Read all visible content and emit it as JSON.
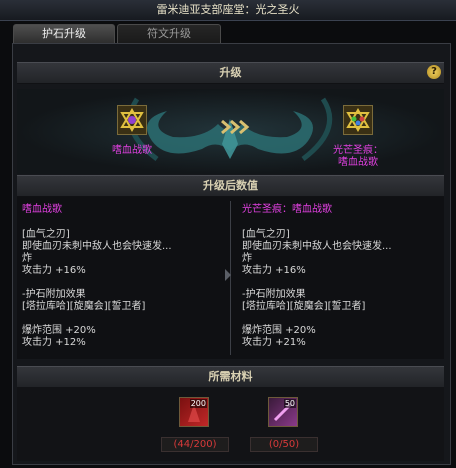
{
  "window": {
    "title": "雷米迪亚支部座堂：光之圣火"
  },
  "tabs": [
    {
      "label": "护石升级",
      "active": true
    },
    {
      "label": "符文升级",
      "active": false
    }
  ],
  "upgrade": {
    "header": "升级",
    "help": "?",
    "source_name": "嗜血战歌",
    "target_name_line1": "光芒圣痕：",
    "target_name_line2": "嗜血战歌"
  },
  "after": {
    "header": "升级后数值",
    "left": {
      "name": "嗜血战歌",
      "lines": [
        "[血气之刃]",
        "即使血刃未刺中敌人也会快速发...",
        "炸",
        "攻击力 +16%",
        "",
        "-护石附加效果",
        "[塔拉库哈][旋魔会][誓卫者]",
        "",
        "爆炸范围 +20%",
        "攻击力 +12%"
      ]
    },
    "right": {
      "name": "光芒圣痕：嗜血战歌",
      "lines": [
        "[血气之刃]",
        "即使血刃未刺中敌人也会快速发...",
        "炸",
        "攻击力 +16%",
        "",
        "-护石附加效果",
        "[塔拉库哈][旋魔会][誓卫者]",
        "",
        "爆炸范围 +20%",
        "攻击力 +21%"
      ]
    }
  },
  "materials": {
    "header": "所需材料",
    "items": [
      {
        "count": "200",
        "required": "(44/200)"
      },
      {
        "count": "50",
        "required": "(0/50)"
      }
    ]
  },
  "colors": {
    "purple_name": "#e040e0",
    "insufficient": "#d83a3a"
  }
}
